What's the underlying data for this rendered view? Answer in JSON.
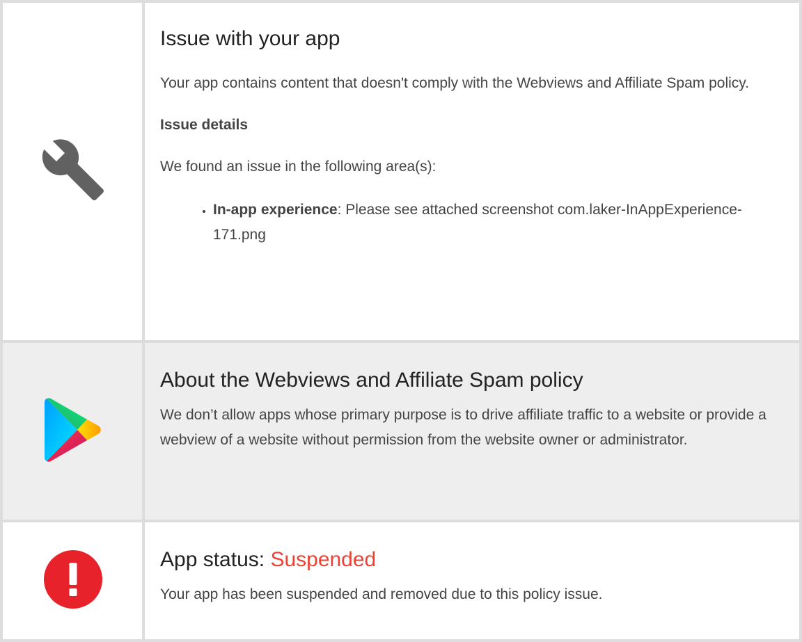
{
  "issue": {
    "title": "Issue with your app",
    "description": "Your app contains content that doesn't comply with the Webviews and Affiliate Spam policy.",
    "details_heading": "Issue details",
    "areas_intro": "We found an issue in the following area(s):",
    "areas": [
      {
        "name": "In-app experience",
        "separator": ": ",
        "text": "Please see attached screenshot com.laker-InAppExperience-171.png"
      }
    ],
    "icon": "wrench-icon"
  },
  "policy": {
    "title": "About the Webviews and Affiliate Spam policy",
    "description": "We don’t allow apps whose primary purpose is to drive affiliate traffic to a website or provide a webview of a website without permission from the website owner or administrator.",
    "icon": "google-play-icon"
  },
  "status": {
    "label": "App status: ",
    "value": "Suspended",
    "description": "Your app has been suspended and removed due to this policy issue.",
    "icon": "alert-icon",
    "value_color": "#ea4335"
  },
  "colors": {
    "border": "#dddddd",
    "policy_background": "#eeeeee",
    "wrench": "#616161",
    "alert": "#e8222b"
  }
}
